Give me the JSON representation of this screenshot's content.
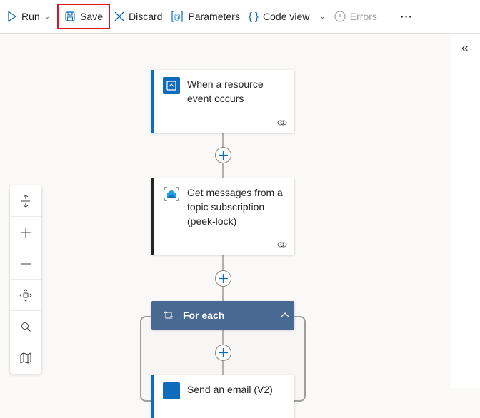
{
  "toolbar": {
    "run": "Run",
    "save": "Save",
    "discard": "Discard",
    "parameters": "Parameters",
    "code_view": "Code view",
    "errors": "Errors"
  },
  "cards": [
    {
      "title": "When a resource event occurs"
    },
    {
      "title": "Get messages from a topic subscription (peek-lock)"
    },
    {
      "title": "Send an email (V2)"
    }
  ],
  "foreach": {
    "title": "For each"
  },
  "colors": {
    "accent": "#0f6cbd",
    "foreach": "#486991",
    "highlight": "#e0141e"
  }
}
